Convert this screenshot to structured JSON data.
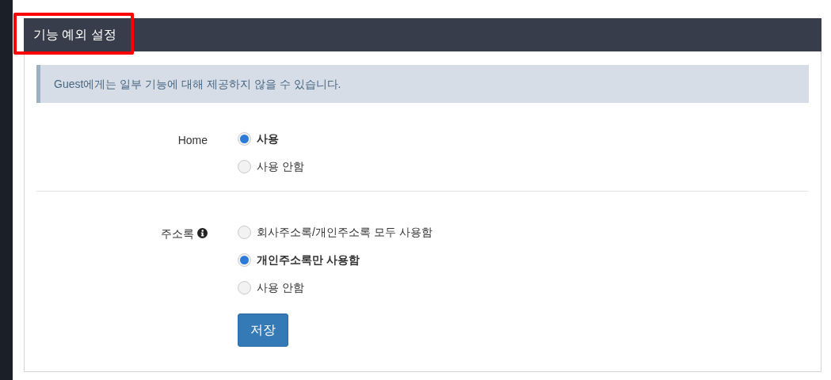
{
  "panel": {
    "title": "기능 예외 설정",
    "title_highlighted": true
  },
  "notice": "Guest에게는 일부 기능에 대해 제공하지 않을 수 있습니다.",
  "settings": [
    {
      "label": "Home",
      "info_icon": false,
      "options": [
        {
          "label": "사용",
          "selected": true
        },
        {
          "label": "사용 안함",
          "selected": false
        }
      ]
    },
    {
      "label": "주소록",
      "info_icon": true,
      "options": [
        {
          "label": "회사주소록/개인주소록 모두 사용함",
          "selected": false
        },
        {
          "label": "개인주소록만 사용함",
          "selected": true
        },
        {
          "label": "사용 안함",
          "selected": false
        }
      ]
    }
  ],
  "save_button": "저장"
}
